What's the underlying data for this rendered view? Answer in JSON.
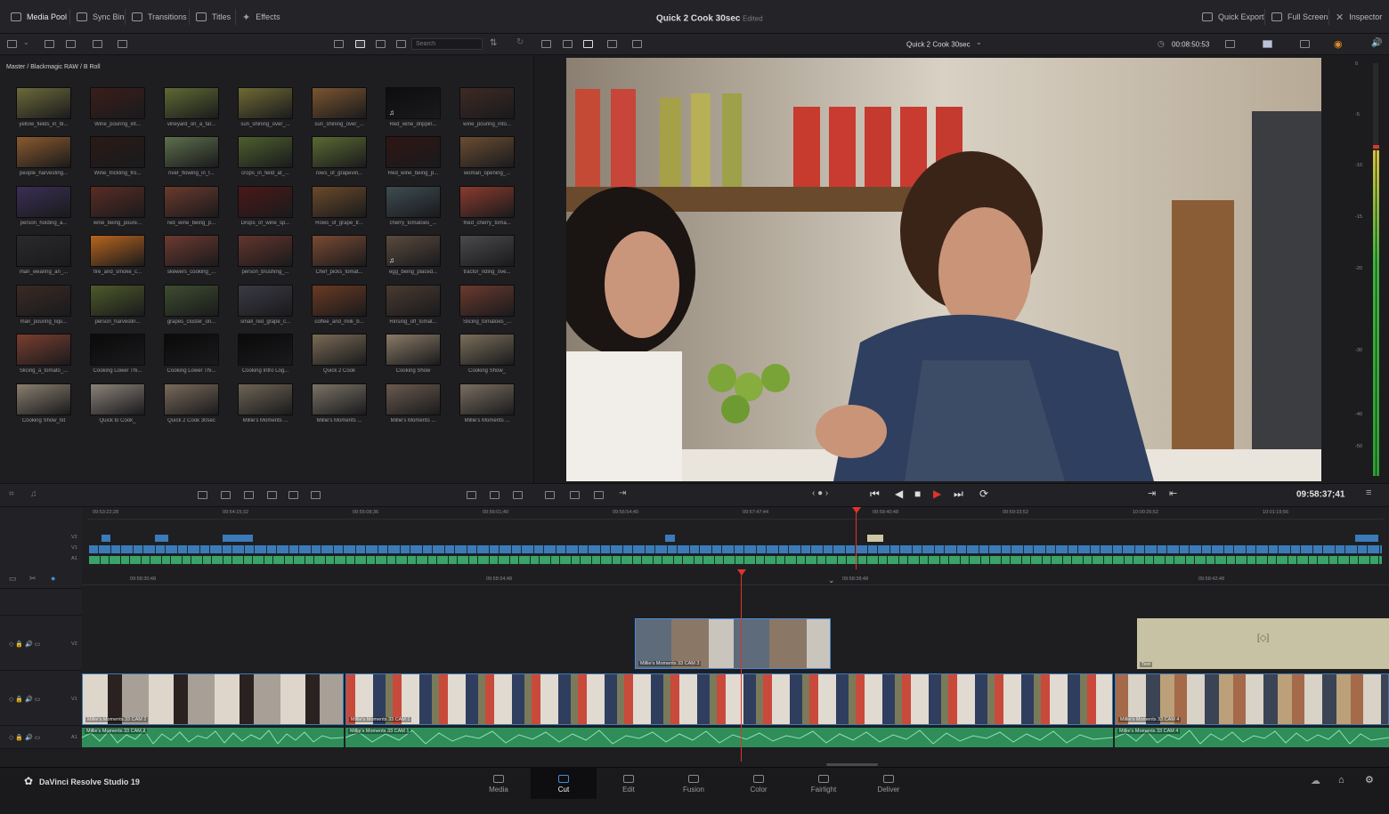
{
  "topbar": {
    "media_pool": "Media Pool",
    "sync_bin": "Sync Bin",
    "transitions": "Transitions",
    "titles": "Titles",
    "effects": "Effects",
    "project_title": "Quick 2 Cook 30sec",
    "project_status": "Edited",
    "quick_export": "Quick Export",
    "full_screen": "Full Screen",
    "inspector": "Inspector"
  },
  "media_pool": {
    "search_placeholder": "Search",
    "breadcrumb": "Master / Blackmagic RAW / B Roll",
    "clips": [
      {
        "label": "yellow_fields_in_bl...",
        "color": "#6b6a3a",
        "audio": false
      },
      {
        "label": "Wine_pouring_int...",
        "color": "#3a1e1a",
        "audio": false
      },
      {
        "label": "vineyard_on_a_far...",
        "color": "#5e6a33",
        "audio": false
      },
      {
        "label": "sun_shining_over_...",
        "color": "#6f6a34",
        "audio": false
      },
      {
        "label": "sun_shining_over_...",
        "color": "#7b5530",
        "audio": false
      },
      {
        "label": "Red_wine_drippin...",
        "color": "#0d0d0f",
        "audio": true
      },
      {
        "label": "wine_pouring_into...",
        "color": "#3d2a24",
        "audio": false
      },
      {
        "label": "people_harvesting...",
        "color": "#8a5a2e",
        "audio": false
      },
      {
        "label": "Wine_trickling_fro...",
        "color": "#2a1a16",
        "audio": false
      },
      {
        "label": "river_flowing_in_t...",
        "color": "#5d6f4c",
        "audio": false
      },
      {
        "label": "crops_in_field_at_...",
        "color": "#4d5f2e",
        "audio": false
      },
      {
        "label": "rows_of_grapevin...",
        "color": "#5b6a32",
        "audio": false
      },
      {
        "label": "Red_wine_being_p...",
        "color": "#2f1614",
        "audio": false
      },
      {
        "label": "woman_opening_...",
        "color": "#6a4d33",
        "audio": false
      },
      {
        "label": "person_holding_a...",
        "color": "#3a2f55",
        "audio": false
      },
      {
        "label": "wine_being_poure...",
        "color": "#5a2d24",
        "audio": false
      },
      {
        "label": "red_wine_being_p...",
        "color": "#6a3a2d",
        "audio": false
      },
      {
        "label": "Drops_of_wine_sp...",
        "color": "#4b1818",
        "audio": false
      },
      {
        "label": "Rows_of_grape_tr...",
        "color": "#6b4a2b",
        "audio": false
      },
      {
        "label": "cherry_tomatoes_...",
        "color": "#3d4c52",
        "audio": false
      },
      {
        "label": "fried_cherry_toma...",
        "color": "#8a3b2e",
        "audio": false
      },
      {
        "label": "man_wearing_an_...",
        "color": "#2a2a2c",
        "audio": false
      },
      {
        "label": "fire_and_smoke_c...",
        "color": "#b8651e",
        "audio": false
      },
      {
        "label": "skewers_cooking_...",
        "color": "#6d3a30",
        "audio": false
      },
      {
        "label": "person_brushing_...",
        "color": "#63352d",
        "audio": false
      },
      {
        "label": "Chef_picks_tomat...",
        "color": "#7a4a33",
        "audio": false
      },
      {
        "label": "egg_being_placed...",
        "color": "#5a4a3e",
        "audio": true
      },
      {
        "label": "tractor_riding_ove...",
        "color": "#4a4a4e",
        "audio": false
      },
      {
        "label": "man_pouring_liqu...",
        "color": "#3a2a24",
        "audio": false
      },
      {
        "label": "person_harvestin...",
        "color": "#4d5a2a",
        "audio": false
      },
      {
        "label": "grapes_cluster_on...",
        "color": "#3e4d30",
        "audio": false
      },
      {
        "label": "small_red_grape_c...",
        "color": "#3a3a44",
        "audio": false
      },
      {
        "label": "coffee_and_milk_b...",
        "color": "#6a3a22",
        "audio": false
      },
      {
        "label": "Rinsing_off_tomat...",
        "color": "#4a3a30",
        "audio": false
      },
      {
        "label": "Slicing_tomatoes_...",
        "color": "#6b3a2e",
        "audio": false
      },
      {
        "label": "Slicing_a_tomato_...",
        "color": "#7a3e30",
        "audio": false
      },
      {
        "label": "Cooking Lower Thi...",
        "color": "#0a0a0b",
        "audio": false
      },
      {
        "label": "Cooking Lower Thi...",
        "color": "#0a0a0b",
        "audio": false
      },
      {
        "label": "Cooking Intro Log...",
        "color": "#0a0a0b",
        "audio": false
      },
      {
        "label": "Quick 2 Cook",
        "color": "#7a6a55",
        "audio": false
      },
      {
        "label": "Cooking Show",
        "color": "#8a7a66",
        "audio": false
      },
      {
        "label": "Cooking Show_",
        "color": "#7a6e5a",
        "audio": false
      },
      {
        "label": "Cooking Show_txt",
        "color": "#8a7e6e",
        "audio": false
      },
      {
        "label": "Quick to Cook_",
        "color": "#8a8278",
        "audio": false
      },
      {
        "label": "Quick 2 Cook 30sec",
        "color": "#7a6a5a",
        "audio": false
      },
      {
        "label": "Millie's Moments ...",
        "color": "#6e6454",
        "audio": false
      },
      {
        "label": "Millie's Moments ...",
        "color": "#7a7266",
        "audio": false
      },
      {
        "label": "Millie's Moments ...",
        "color": "#6a5a4e",
        "audio": false
      },
      {
        "label": "Millie's Moments ...",
        "color": "#7a6e60",
        "audio": false
      }
    ]
  },
  "viewer": {
    "sequence_title": "Quick 2 Cook 30sec",
    "timecode_top": "00:08:50:53",
    "meter_scale": [
      "0",
      "-5",
      "-10",
      "-15",
      "-20",
      "-30",
      "-40",
      "-50"
    ]
  },
  "transport": {
    "timecode": "09:58:37;41"
  },
  "upper_timeline": {
    "ruler": [
      "09:53:22;28",
      "09:54:15;32",
      "09:55:08;36",
      "09:56:01;40",
      "09:56:54;40",
      "09:57:47;44",
      "09:58:40;48",
      "09:59:33;52",
      "10:00:26;52",
      "10:01:19;56"
    ],
    "tracks": [
      "V2",
      "V1",
      "A1"
    ]
  },
  "lower_timeline": {
    "ruler": [
      "09:58:30;48",
      "09:58:34;48",
      "09:58:38;48",
      "09:58:42;48"
    ],
    "tracks": [
      "V2",
      "V1",
      "A1"
    ],
    "v2_clip": "Millie's Moments 33 CAM 3",
    "text_clip": "Text",
    "v1_clips": [
      "Millie's Moments 33 CAM 2",
      "Millie's Moments 33 CAM 1",
      "Millie's Moments 33 CAM 4"
    ],
    "a1_clips": [
      "Millie's Moments 33 CAM 2",
      "Millie's Moments 33 CAM 1",
      "Millie's Moments 33 CAM 4"
    ]
  },
  "pages": [
    "Media",
    "Cut",
    "Edit",
    "Fusion",
    "Color",
    "Fairlight",
    "Deliver"
  ],
  "active_page": "Cut",
  "app_name": "DaVinci Resolve Studio 19",
  "colors": {
    "accent": "#4a8ad8",
    "playhead": "#e0332b",
    "video_clip": "#3a7ab8",
    "audio_clip": "#3aa36a"
  }
}
